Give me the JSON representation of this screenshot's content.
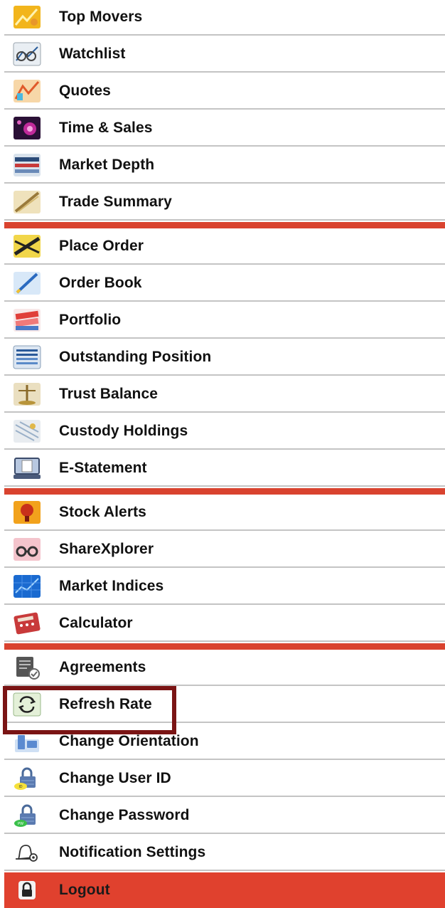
{
  "menu": {
    "items": [
      {
        "label": "Top Movers",
        "icon": "top-movers-icon"
      },
      {
        "label": "Watchlist",
        "icon": "watchlist-icon"
      },
      {
        "label": "Quotes",
        "icon": "quotes-icon"
      },
      {
        "label": "Time & Sales",
        "icon": "time-sales-icon"
      },
      {
        "label": "Market Depth",
        "icon": "market-depth-icon"
      },
      {
        "label": "Trade Summary",
        "icon": "trade-summary-icon"
      },
      {
        "label": "Place Order",
        "icon": "place-order-icon"
      },
      {
        "label": "Order Book",
        "icon": "order-book-icon"
      },
      {
        "label": "Portfolio",
        "icon": "portfolio-icon"
      },
      {
        "label": "Outstanding Position",
        "icon": "outstanding-position-icon"
      },
      {
        "label": "Trust Balance",
        "icon": "trust-balance-icon"
      },
      {
        "label": "Custody Holdings",
        "icon": "custody-holdings-icon"
      },
      {
        "label": "E-Statement",
        "icon": "e-statement-icon"
      },
      {
        "label": "Stock Alerts",
        "icon": "stock-alerts-icon"
      },
      {
        "label": "ShareXplorer",
        "icon": "sharexplorer-icon"
      },
      {
        "label": "Market Indices",
        "icon": "market-indices-icon"
      },
      {
        "label": "Calculator",
        "icon": "calculator-icon"
      },
      {
        "label": "Agreements",
        "icon": "agreements-icon"
      },
      {
        "label": "Refresh Rate",
        "icon": "refresh-icon"
      },
      {
        "label": "Change Orientation",
        "icon": "orientation-icon"
      },
      {
        "label": "Change User ID",
        "icon": "user-id-lock-icon"
      },
      {
        "label": "Change Password",
        "icon": "password-lock-icon"
      },
      {
        "label": "Notification Settings",
        "icon": "notification-settings-icon"
      },
      {
        "label": "Logout",
        "icon": "padlock-icon"
      }
    ],
    "highlighted": "Refresh Rate"
  },
  "colors": {
    "separator": "#d9432f",
    "logout_bg": "#e0412e",
    "highlight_border": "#7a1414",
    "divider": "#c4c4c4"
  }
}
